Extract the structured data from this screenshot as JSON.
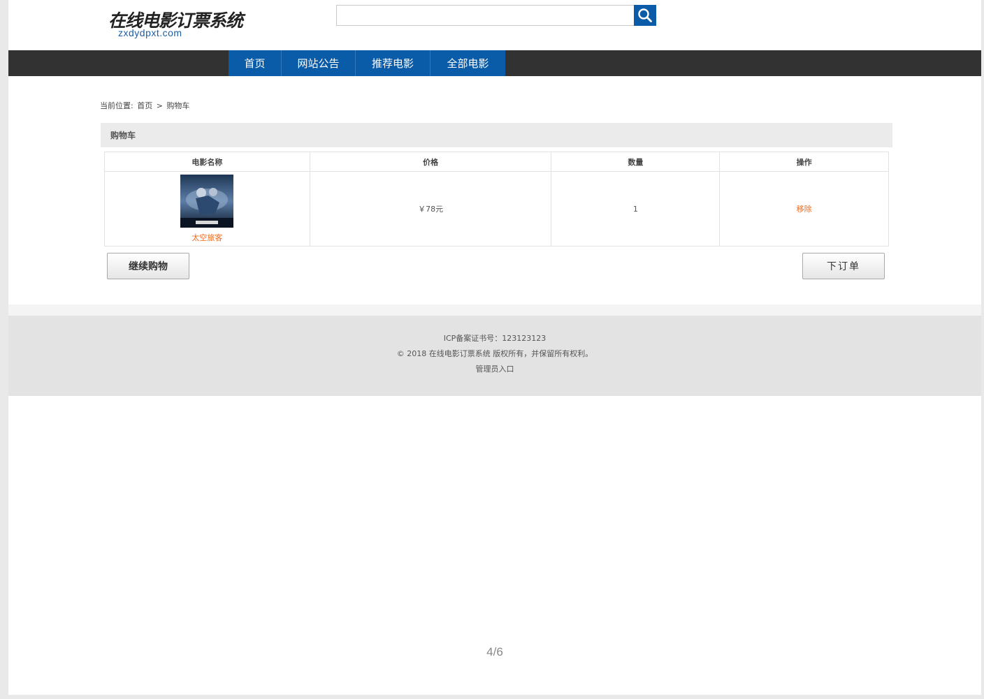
{
  "header": {
    "logo_text": "在线电影订票系统",
    "logo_domain": "zxdydpxt.com",
    "search_placeholder": "",
    "search_icon": "search-icon"
  },
  "nav": {
    "items": [
      {
        "label": "首页"
      },
      {
        "label": "网站公告"
      },
      {
        "label": "推荐电影"
      },
      {
        "label": "全部电影"
      }
    ]
  },
  "breadcrumb": {
    "prefix": "当前位置:",
    "home": "首页",
    "separator": ">",
    "current": "购物车"
  },
  "cart": {
    "title": "购物车",
    "columns": [
      "电影名称",
      "价格",
      "数量",
      "操作"
    ],
    "rows": [
      {
        "name": "太空旅客",
        "price": "￥78元",
        "quantity": "1",
        "action": "移除"
      }
    ],
    "continue_label": "继续购物",
    "order_label": "下订单"
  },
  "footer": {
    "icp": "ICP备案证书号：123123123",
    "copyright": "© 2018 在线电影订票系统 版权所有，并保留所有权利。",
    "admin": "管理员入口"
  },
  "pager": "4/6",
  "colors": {
    "brand_blue": "#0a5ca8",
    "nav_dark": "#323232",
    "accent_orange": "#f06b1f"
  }
}
